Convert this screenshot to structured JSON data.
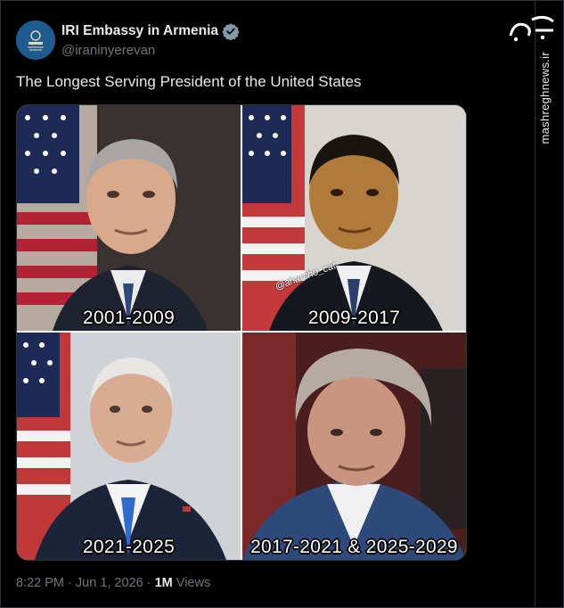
{
  "account": {
    "display_name": "IRI Embassy in Armenia",
    "handle": "@iraninyerevan",
    "verified": true
  },
  "tweet": {
    "text": "The Longest Serving President of the United States",
    "time": "8:22 PM",
    "separator": "·",
    "date": "Jun 1, 2026",
    "views_count": "1M",
    "views_label": "Views"
  },
  "media": {
    "panels": [
      {
        "caption": "2001-2009"
      },
      {
        "caption": "2009-2017"
      },
      {
        "caption": "2021-2025"
      },
      {
        "caption": "2017-2021 & 2025-2029"
      }
    ],
    "watermark": "@aharcho_cat"
  },
  "site": {
    "vertical_url": "mashreghnews.ir"
  },
  "colors": {
    "background": "#000000",
    "text_primary": "#e7e9ea",
    "text_secondary": "#71767b",
    "verified_badge": "#829aab"
  }
}
